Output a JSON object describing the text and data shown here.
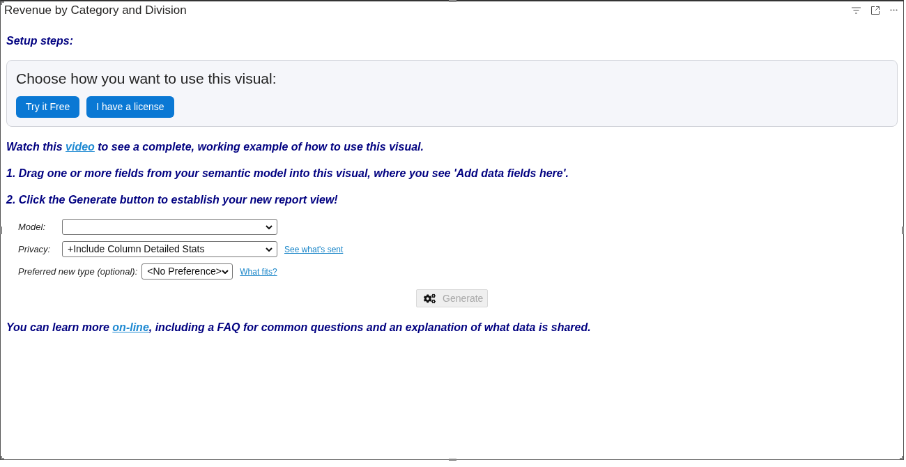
{
  "visual": {
    "title": "Revenue by Category and Division"
  },
  "setup": {
    "heading": "Setup steps:"
  },
  "license_panel": {
    "heading": "Choose how you want to use this visual:",
    "buttons": [
      "Try it Free",
      "I have a license"
    ]
  },
  "instructions": [
    {
      "kind": "link_sentence",
      "before": "Watch this ",
      "link": "video",
      "after": " to see a complete, working example of how to use this visual."
    },
    {
      "kind": "plain",
      "text": "1. Drag one or more fields from your semantic model into this visual, where you see 'Add data fields here'."
    },
    {
      "kind": "plain",
      "text": "2. Click the Generate button to establish your new report view!"
    }
  ],
  "form": {
    "fields": [
      {
        "label": "Model:"
      },
      {
        "label": "Privacy:",
        "value": "+Include Column Detailed Stats",
        "link": "See what's sent"
      },
      {
        "label": "Preferred new type (optional):",
        "value": "<No Preference>",
        "link": "What fits?"
      }
    ],
    "generate": {
      "label": "Generate",
      "disabled": true
    }
  },
  "footer_note": {
    "before": "You can learn more ",
    "link": "on-line",
    "after": ", including a FAQ for common questions and an explanation of what data is shared."
  }
}
